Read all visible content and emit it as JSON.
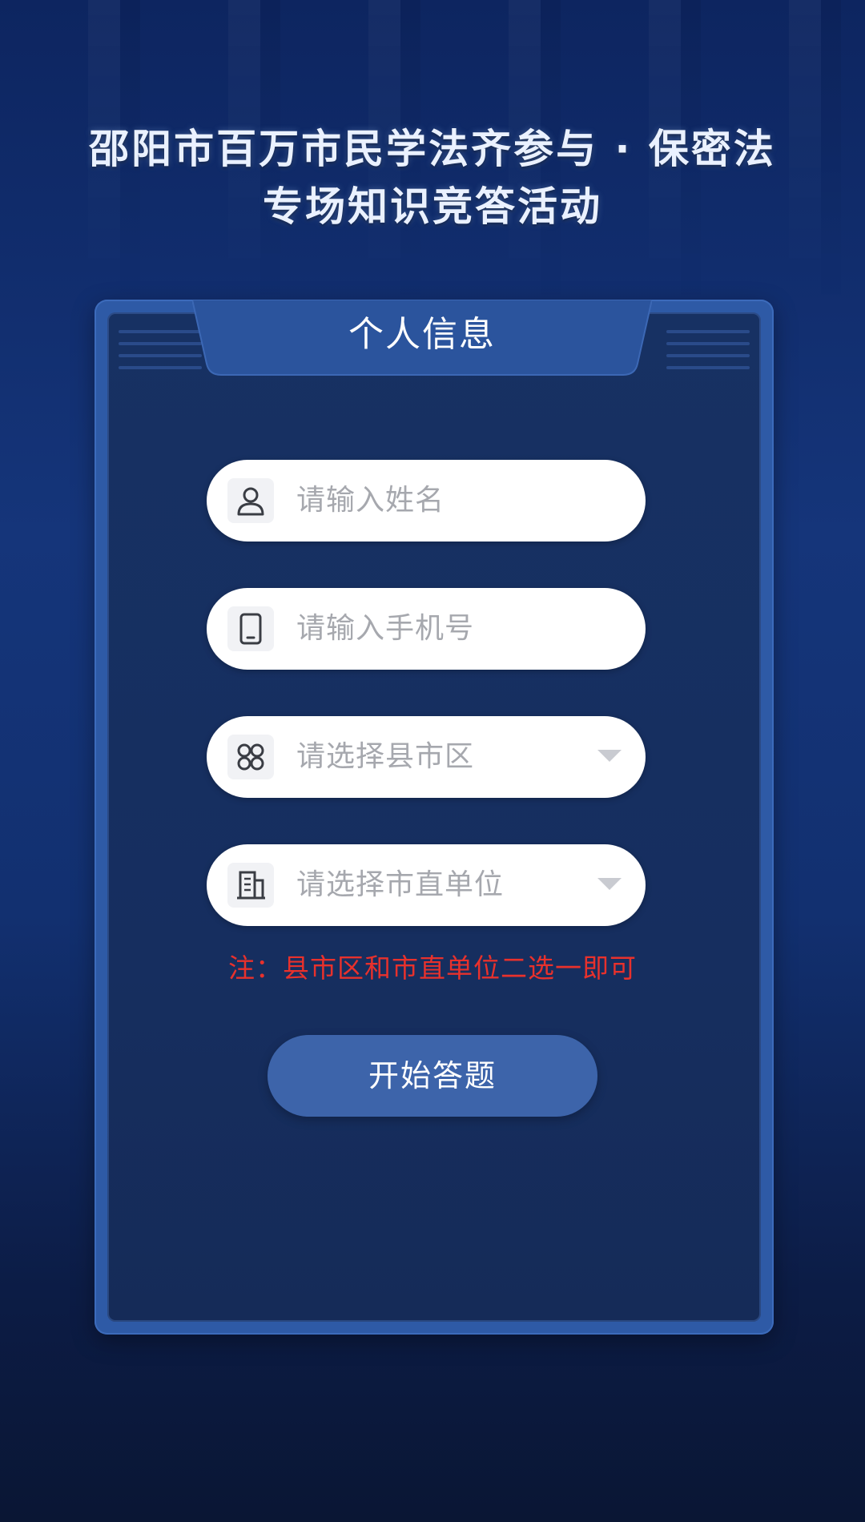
{
  "header": {
    "title_line1": "邵阳市百万市民学法齐参与 · 保密法",
    "title_line2": "专场知识竞答活动"
  },
  "card": {
    "tab_title": "个人信息"
  },
  "form": {
    "name": {
      "placeholder": "请输入姓名",
      "icon": "person-icon"
    },
    "phone": {
      "placeholder": "请输入手机号",
      "icon": "phone-icon"
    },
    "district": {
      "placeholder": "请选择县市区",
      "icon": "grid-icon"
    },
    "unit": {
      "placeholder": "请选择市直单位",
      "icon": "building-icon"
    },
    "note": "注：县市区和市直单位二选一即可",
    "submit_label": "开始答题"
  },
  "colors": {
    "background": "#0f2350",
    "card_border": "#2e5aa6",
    "card_fill": "#173163",
    "note": "#e8312c",
    "button": "#3d64aa"
  }
}
